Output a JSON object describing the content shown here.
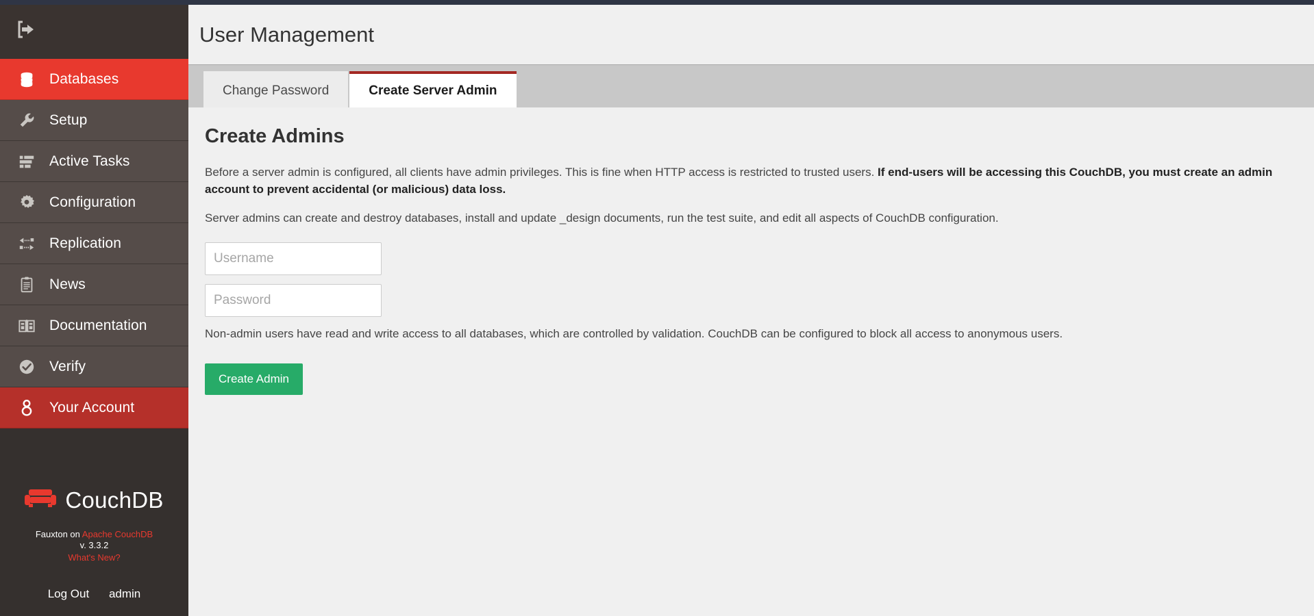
{
  "window": {
    "top_strip_color": "#2f3545"
  },
  "sidebar": {
    "collapse_icon": "collapse-sidebar-icon",
    "items": [
      {
        "label": "Databases",
        "icon": "database-icon",
        "state": "active-bright"
      },
      {
        "label": "Setup",
        "icon": "wrench-icon",
        "state": "normal"
      },
      {
        "label": "Active Tasks",
        "icon": "tasks-icon",
        "state": "normal"
      },
      {
        "label": "Configuration",
        "icon": "gear-icon",
        "state": "normal"
      },
      {
        "label": "Replication",
        "icon": "replication-icon",
        "state": "normal"
      },
      {
        "label": "News",
        "icon": "clipboard-icon",
        "state": "normal"
      },
      {
        "label": "Documentation",
        "icon": "book-icon",
        "state": "normal"
      },
      {
        "label": "Verify",
        "icon": "check-circle-icon",
        "state": "normal"
      },
      {
        "label": "Your Account",
        "icon": "user-icon",
        "state": "active-dark"
      }
    ],
    "brand": {
      "name": "CouchDB",
      "logo_icon": "couch-logo-icon",
      "accent_color": "#e8392e"
    },
    "footer": {
      "fauxton_prefix": "Fauxton on",
      "couchdb_link": "Apache CouchDB",
      "version": "v. 3.3.2",
      "whats_new": "What's New?",
      "log_out": "Log Out",
      "username": "admin"
    }
  },
  "header": {
    "title": "User Management"
  },
  "tabs": [
    {
      "label": "Change Password",
      "active": false
    },
    {
      "label": "Create Server Admin",
      "active": true
    }
  ],
  "main": {
    "section_title": "Create Admins",
    "intro_normal_1": "Before a server admin is configured, all clients have admin privileges. This is fine when HTTP access is restricted to trusted users. ",
    "intro_bold": "If end-users will be accessing this CouchDB, you must create an admin account to prevent accidental (or malicious) data loss.",
    "privileges_para": "Server admins can create and destroy databases, install and update _design documents, run the test suite, and edit all aspects of CouchDB configuration.",
    "username_placeholder": "Username",
    "username_value": "",
    "password_placeholder": "Password",
    "password_value": "",
    "nonadmin_para": "Non-admin users have read and write access to all databases, which are controlled by validation. CouchDB can be configured to block all access to anonymous users.",
    "create_button": "Create Admin",
    "create_button_color": "#27ab68"
  }
}
